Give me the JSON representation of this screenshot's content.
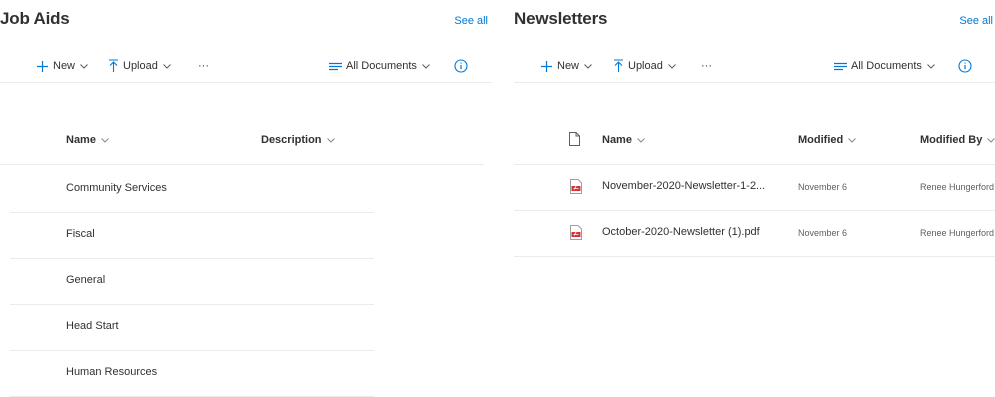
{
  "job_aids": {
    "title": "Job Aids",
    "see_all": "See all",
    "toolbar": {
      "new": "New",
      "upload": "Upload",
      "more": "···",
      "view": "All Documents"
    },
    "columns": {
      "name": "Name",
      "description": "Description"
    },
    "items": [
      {
        "name": "Community Services"
      },
      {
        "name": "Fiscal"
      },
      {
        "name": "General"
      },
      {
        "name": "Head Start"
      },
      {
        "name": "Human Resources"
      }
    ]
  },
  "newsletters": {
    "title": "Newsletters",
    "see_all": "See all",
    "toolbar": {
      "new": "New",
      "upload": "Upload",
      "more": "···",
      "view": "All Documents"
    },
    "columns": {
      "name": "Name",
      "modified": "Modified",
      "modified_by": "Modified By"
    },
    "items": [
      {
        "name": "November-2020-Newsletter-1-2...",
        "modified": "November 6",
        "modified_by": "Renee Hungerford"
      },
      {
        "name": "October-2020-Newsletter (1).pdf",
        "modified": "November 6",
        "modified_by": "Renee Hungerford"
      }
    ]
  },
  "colors": {
    "accent": "#0078d4",
    "text": "#323130",
    "divider": "#edebe9",
    "pdf": "#d13438"
  }
}
